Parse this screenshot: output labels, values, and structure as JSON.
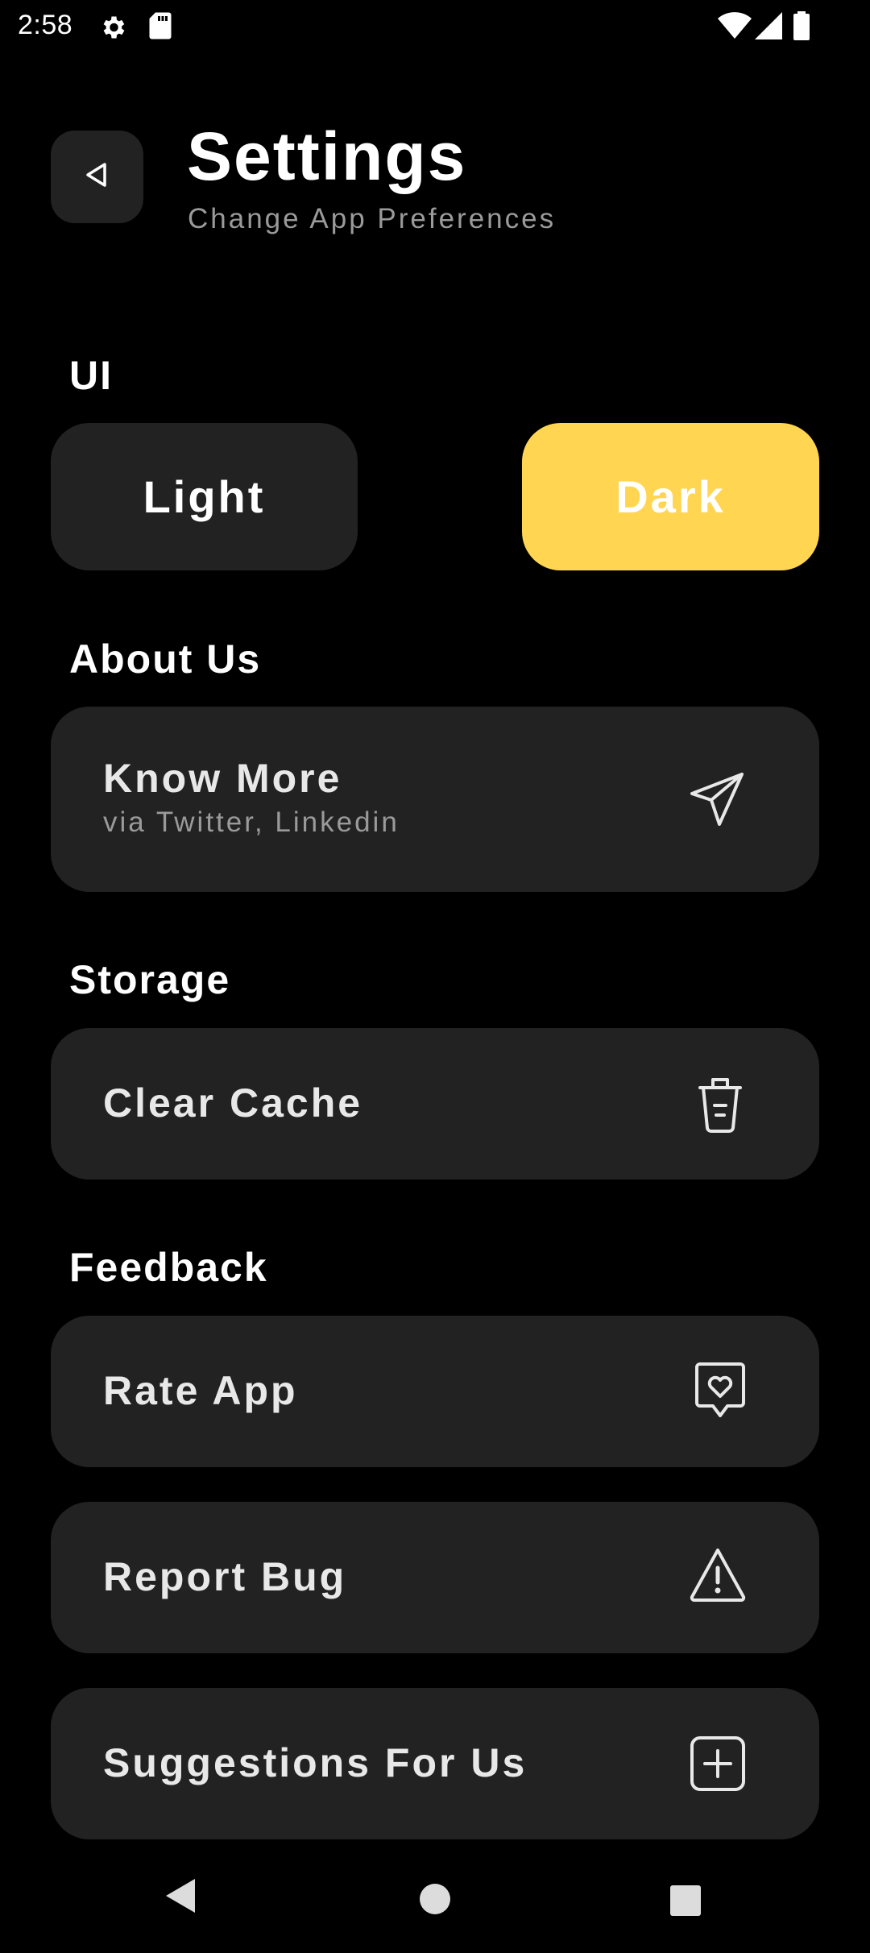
{
  "status_bar": {
    "time": "2:58",
    "icons": [
      "settings-gear-icon",
      "sd-card-icon",
      "wifi-icon",
      "cellular-signal-icon",
      "battery-icon"
    ]
  },
  "header": {
    "title": "Settings",
    "subtitle": "Change App Preferences",
    "back_icon": "back-arrow-icon"
  },
  "ui_section": {
    "heading": "UI",
    "options": [
      {
        "label": "Light",
        "selected": false
      },
      {
        "label": "Dark",
        "selected": true
      }
    ],
    "accent_color": "#FFD551"
  },
  "about_section": {
    "heading": "About Us",
    "know_more": {
      "label": "Know More",
      "sub": "via Twitter, Linkedin",
      "icon": "send-icon"
    }
  },
  "storage_section": {
    "heading": "Storage",
    "clear_cache": {
      "label": "Clear Cache",
      "icon": "trash-icon"
    }
  },
  "feedback_section": {
    "heading": "Feedback",
    "items": [
      {
        "label": "Rate App",
        "icon": "heart-badge-icon"
      },
      {
        "label": "Report Bug",
        "icon": "warning-triangle-icon"
      },
      {
        "label": "Suggestions For Us",
        "icon": "plus-square-icon"
      }
    ]
  },
  "nav_bar": {
    "icons": [
      "nav-back-icon",
      "nav-home-icon",
      "nav-recents-icon"
    ]
  }
}
